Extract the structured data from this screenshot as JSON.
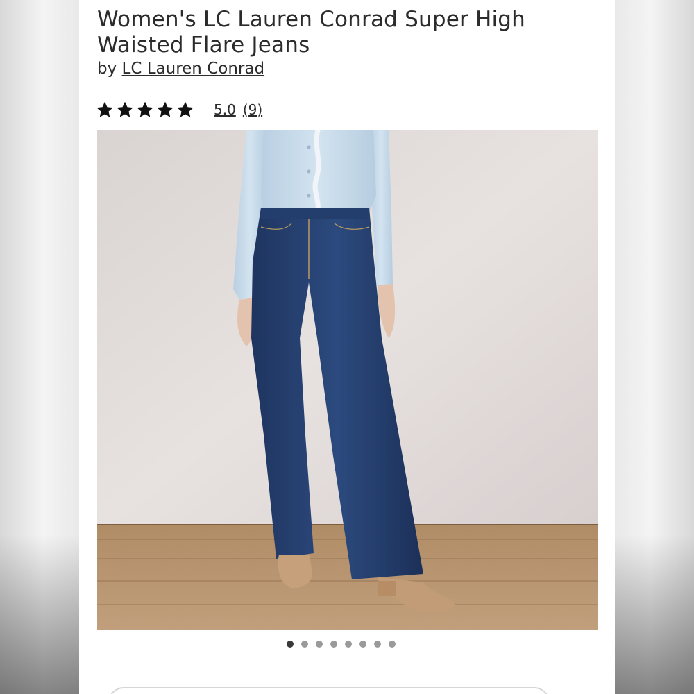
{
  "product": {
    "title": "Women's LC Lauren Conrad Super High Waisted Flare Jeans",
    "by_prefix": "by",
    "brand": "LC Lauren Conrad"
  },
  "rating": {
    "stars": 5,
    "score": "5.0",
    "count": "(9)"
  },
  "gallery": {
    "image_description_icon": "product-photo",
    "dot_count": 8,
    "active_index": 0
  },
  "colors": {
    "text": "#2b2b2b",
    "dot_active": "#3a3a3a",
    "dot_inactive": "#9a9a9a"
  }
}
